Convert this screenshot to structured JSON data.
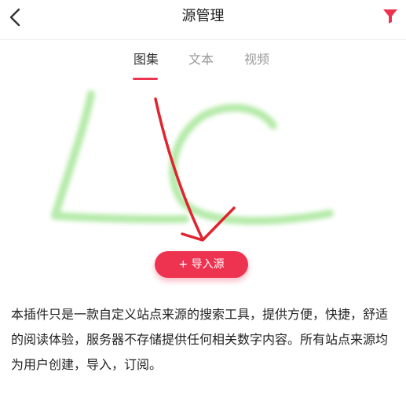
{
  "colors": {
    "accent": "#ee3350",
    "title": "#222222",
    "tab_inactive": "#999999",
    "tab_active": "#333333",
    "doodle_green": "#9be38c",
    "arrow_red": "#e0242f"
  },
  "header": {
    "title": "源管理",
    "back_icon": "chevron-left-icon",
    "filter_icon": "funnel-icon"
  },
  "tabs": [
    {
      "label": "图集",
      "active": true
    },
    {
      "label": "文本",
      "active": false
    },
    {
      "label": "视频",
      "active": false
    }
  ],
  "import_button": {
    "label": "+ 导入源"
  },
  "description": "本插件只是一款自定义站点来源的搜索工具，提供方便，快捷，舒适的阅读体验，服务器不存储提供任何相关数字内容。所有站点来源均为用户创建，导入，订阅。"
}
